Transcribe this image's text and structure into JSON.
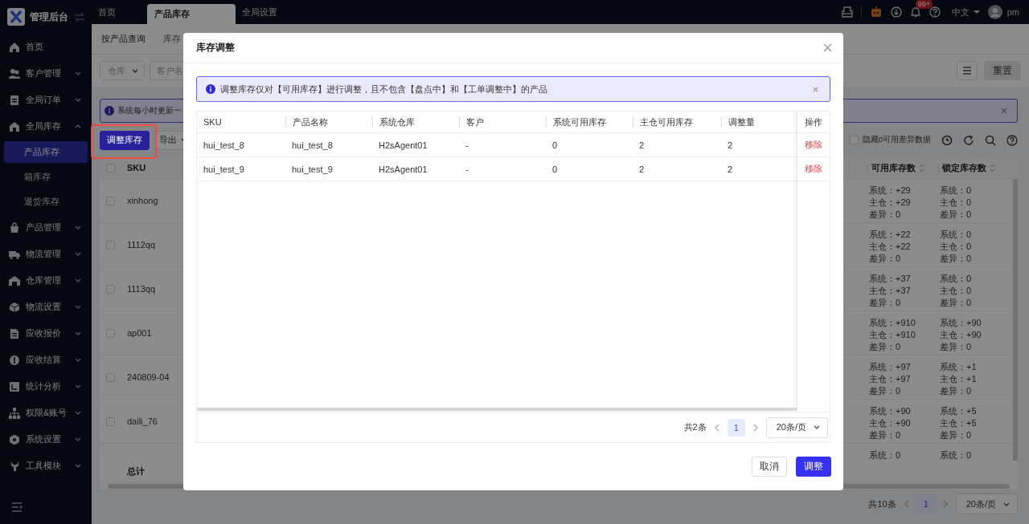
{
  "app": {
    "title": "管理后台"
  },
  "sidebar": {
    "items": [
      {
        "label": "首页"
      },
      {
        "label": "客户管理",
        "expanded": false
      },
      {
        "label": "全局订单",
        "expanded": false
      },
      {
        "label": "全局库存",
        "expanded": true,
        "children": [
          {
            "label": "产品库存",
            "selected": true
          },
          {
            "label": "箱库存",
            "selected": false
          },
          {
            "label": "退货库存",
            "selected": false
          }
        ]
      },
      {
        "label": "产品管理",
        "expanded": false
      },
      {
        "label": "物流管理",
        "expanded": false
      },
      {
        "label": "仓库管理",
        "expanded": false
      },
      {
        "label": "物流设置",
        "expanded": false
      },
      {
        "label": "应收报价",
        "expanded": false
      },
      {
        "label": "应收结算",
        "expanded": false
      },
      {
        "label": "统计分析",
        "expanded": false
      },
      {
        "label": "权限&账号",
        "expanded": false
      },
      {
        "label": "系统设置",
        "expanded": false
      },
      {
        "label": "工具模块",
        "expanded": false
      }
    ]
  },
  "page_tabs": [
    {
      "label": "首页",
      "selected": false
    },
    {
      "label": "产品库存",
      "selected": true
    },
    {
      "label": "全局设置",
      "selected": false
    }
  ],
  "header": {
    "notification_badge": "99+",
    "language": "中文",
    "language_menu_expanded": false,
    "user": "pm"
  },
  "sub_tabs": [
    {
      "label": "按产品查询",
      "selected": true
    },
    {
      "label": "库存",
      "selected": false
    }
  ],
  "filters": [
    {
      "kind": "select",
      "placeholder": "仓库"
    },
    {
      "kind": "input",
      "placeholder": "客户名"
    }
  ],
  "filter_buttons": {
    "reset": "重置"
  },
  "alert": {
    "text": "系统每小时更新一"
  },
  "toolbar": {
    "primary": {
      "label": "调整库存",
      "highlighted": true
    },
    "export": "导出",
    "hide_zero": {
      "label": "隐藏0可用差异数据",
      "checked": false
    }
  },
  "table": {
    "columns": [
      "SKU",
      "可用库存数",
      "锁定库存数"
    ],
    "all_checked": false,
    "rows": [
      {
        "checked": false,
        "sku": "xinhong",
        "available": [
          "系统：+29",
          "主仓：+29",
          "差异：0"
        ],
        "locked": [
          "系统：0",
          "主仓：0",
          "差异：0"
        ]
      },
      {
        "checked": false,
        "sku": "1112qq",
        "available": [
          "系统：+22",
          "主仓：+22",
          "差异：0"
        ],
        "locked": [
          "系统：0",
          "主仓：0",
          "差异：0"
        ]
      },
      {
        "checked": false,
        "sku": "1113qq",
        "available": [
          "系统：+37",
          "主仓：+37",
          "差异：0"
        ],
        "locked": [
          "系统：0",
          "主仓：0",
          "差异：0"
        ]
      },
      {
        "checked": false,
        "sku": "ap001",
        "available": [
          "系统：+910",
          "主仓：+910",
          "差异：0"
        ],
        "locked": [
          "系统：+90",
          "主仓：+90",
          "差异：0"
        ]
      },
      {
        "checked": false,
        "sku": "240809-04",
        "available": [
          "系统：+97",
          "主仓：+97",
          "差异：0"
        ],
        "locked": [
          "系统：+1",
          "主仓：+1",
          "差异：0"
        ]
      },
      {
        "checked": false,
        "sku": "daili_76",
        "available": [
          "系统：+90",
          "主仓：+90",
          "差异：0"
        ],
        "locked": [
          "系统：+5",
          "主仓：+5",
          "差异：0"
        ]
      },
      {
        "available": [
          "系统：0"
        ],
        "locked": [
          "系统：0"
        ]
      }
    ],
    "total_label": "总计"
  },
  "pagination": {
    "total": "共10条",
    "page": "1",
    "page_size": "20条/页"
  },
  "dialog": {
    "title": "库存调整",
    "notice": "调整库存仅对【可用库存】进行调整，且不包含【盘点中】和【工单调整中】的产品",
    "columns": [
      "SKU",
      "产品名称",
      "系统仓库",
      "客户",
      "系统可用库存",
      "主仓可用库存",
      "调整量",
      "操作"
    ],
    "rows": [
      {
        "cells": [
          "hui_test_8",
          "hui_test_8",
          "H2sAgent01",
          "-",
          "0",
          "2",
          "2"
        ],
        "action": "移除"
      },
      {
        "cells": [
          "hui_test_9",
          "hui_test_9",
          "H2sAgent01",
          "-",
          "0",
          "2",
          "2"
        ],
        "action": "移除"
      }
    ],
    "pagination": {
      "total": "共2条",
      "page": "1",
      "page_size": "20条/页"
    },
    "buttons": {
      "cancel": "取消",
      "confirm": "调整"
    }
  }
}
